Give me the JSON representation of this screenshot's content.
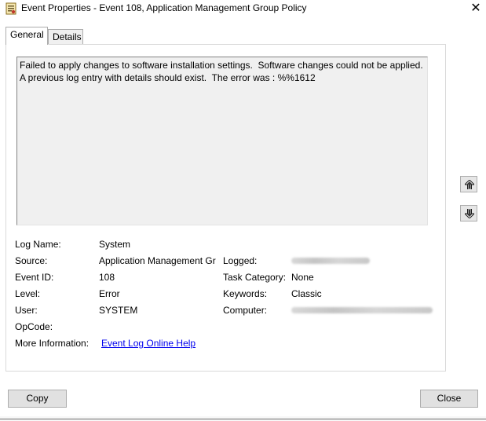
{
  "window": {
    "title": "Event Properties - Event 108, Application Management Group Policy",
    "close_glyph": "✕"
  },
  "tabs": [
    {
      "label": "General",
      "active": true
    },
    {
      "label": "Details",
      "active": false
    }
  ],
  "description": "Failed to apply changes to software installation settings.  Software changes could not be applied.  A previous log entry with details should exist.  The error was : %%1612",
  "fields": {
    "log_name_label": "Log Name:",
    "log_name_value": "System",
    "source_label": "Source:",
    "source_value": "Application Management Gr",
    "logged_label": "Logged:",
    "event_id_label": "Event ID:",
    "event_id_value": "108",
    "task_category_label": "Task Category:",
    "task_category_value": "None",
    "level_label": "Level:",
    "level_value": "Error",
    "keywords_label": "Keywords:",
    "keywords_value": "Classic",
    "user_label": "User:",
    "user_value": "SYSTEM",
    "computer_label": "Computer:",
    "opcode_label": "OpCode:",
    "more_info_label": "More Information:",
    "more_info_link": "Event Log Online Help"
  },
  "buttons": {
    "copy": "Copy",
    "close": "Close"
  },
  "icons": [
    "event-properties-icon",
    "close-icon",
    "arrow-up-icon",
    "arrow-down-icon"
  ]
}
